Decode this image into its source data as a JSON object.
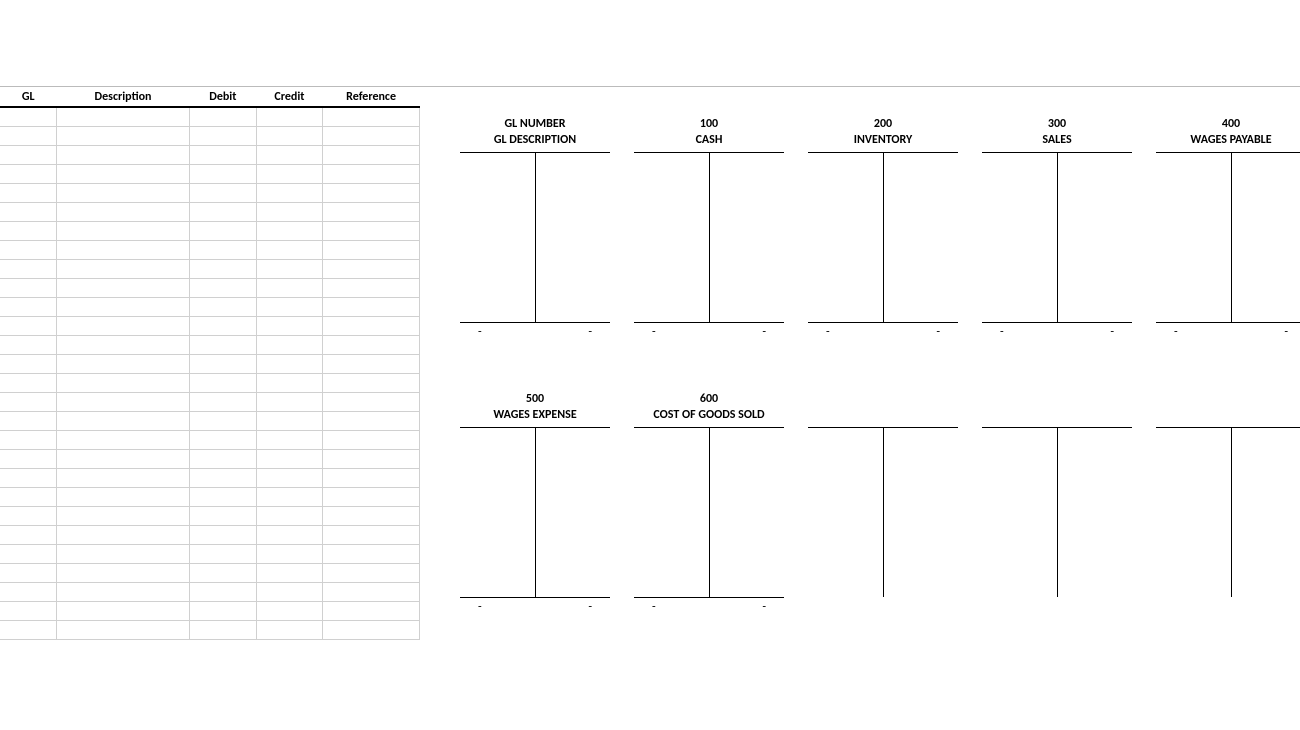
{
  "journal": {
    "headers": {
      "gl": "GL",
      "description": "Description",
      "debit": "Debit",
      "credit": "Credit",
      "reference": "Reference"
    },
    "row_count": 28
  },
  "t_accounts": {
    "row1": [
      {
        "number": "GL NUMBER",
        "desc": "GL DESCRIPTION",
        "debit_total": "-",
        "credit_total": "-"
      },
      {
        "number": "100",
        "desc": "CASH",
        "debit_total": "-",
        "credit_total": "-"
      },
      {
        "number": "200",
        "desc": "INVENTORY",
        "debit_total": "-",
        "credit_total": "-"
      },
      {
        "number": "300",
        "desc": "SALES",
        "debit_total": "-",
        "credit_total": "-"
      },
      {
        "number": "400",
        "desc": "WAGES PAYABLE",
        "debit_total": "-",
        "credit_total": "-"
      }
    ],
    "row2": [
      {
        "number": "500",
        "desc": "WAGES EXPENSE",
        "debit_total": "-",
        "credit_total": "-"
      },
      {
        "number": "600",
        "desc": "COST OF GOODS SOLD",
        "debit_total": "-",
        "credit_total": "-"
      },
      {
        "number": "",
        "desc": "",
        "debit_total": "",
        "credit_total": "",
        "blank": true
      },
      {
        "number": "",
        "desc": "",
        "debit_total": "",
        "credit_total": "",
        "blank": true
      },
      {
        "number": "",
        "desc": "",
        "debit_total": "",
        "credit_total": "",
        "blank": true
      }
    ]
  }
}
